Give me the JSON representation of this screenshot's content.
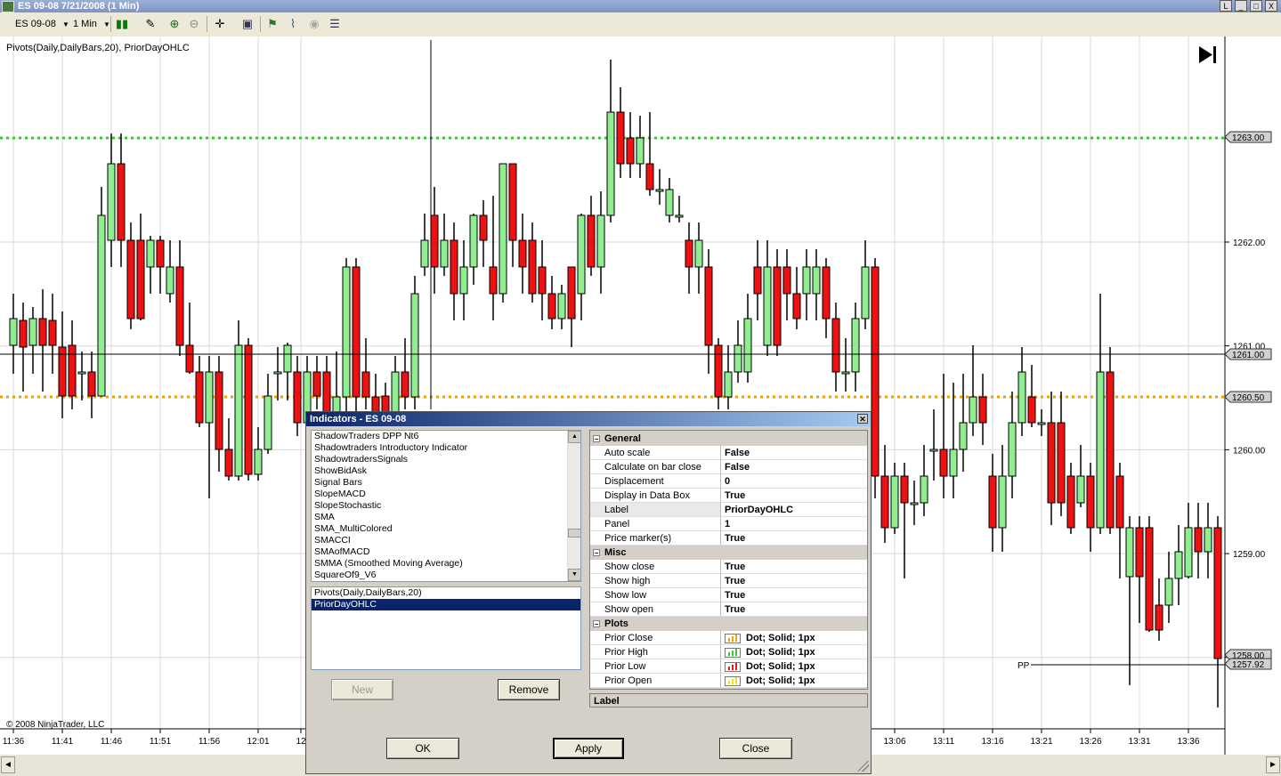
{
  "window": {
    "title": "ES 09-08  7/21/2008 (1 Min)",
    "min_label": "L",
    "restore_label": "_",
    "max_label": "□",
    "close_label": "X"
  },
  "toolbar": {
    "instrument": "ES 09-08",
    "interval": "1 Min"
  },
  "chart": {
    "indicator_label": "Pivots(Daily,DailyBars,20), PriorDayOHLC",
    "copyright": "© 2008 NinjaTrader, LLC",
    "pp_label": "PP",
    "price_ticks": [
      "1263.00",
      "1262.00",
      "1261.00",
      "1260.00",
      "1259.00",
      "1258.00"
    ],
    "price_markers": [
      "1263.00",
      "1261.00",
      "1260.50",
      "1258.00",
      "1257.92"
    ],
    "time_ticks": [
      "11:36",
      "11:41",
      "11:46",
      "11:51",
      "11:56",
      "12:01",
      "12",
      "13:06",
      "13:11",
      "13:16",
      "13:21",
      "13:26",
      "13:31",
      "13:36"
    ],
    "colors": {
      "up": "#90ee90",
      "down": "#ee1111",
      "prior_high": "#33cc33",
      "prior_close": "#f0a000",
      "grid": "#d8d8d8"
    }
  },
  "dialog": {
    "title": "Indicators - ES 09-08",
    "available": [
      "ShadowTraders DPP Nt6",
      "Shadowtraders Introductory Indicator",
      "ShadowtradersSignals",
      "ShowBidAsk",
      "Signal Bars",
      "SlopeMACD",
      "SlopeStochastic",
      "SMA",
      "SMA_MultiColored",
      "SMACCI",
      "SMAofMACD",
      "SMMA (Smoothed Moving Average)",
      "SquareOf9_V6"
    ],
    "applied": [
      "Pivots(Daily,DailyBars,20)",
      "PriorDayOHLC"
    ],
    "new_label": "New",
    "remove_label": "Remove",
    "ok_label": "OK",
    "apply_label": "Apply",
    "close_label": "Close",
    "description_title": "Label",
    "properties": {
      "general_title": "General",
      "general": [
        {
          "k": "Auto scale",
          "v": "False"
        },
        {
          "k": "Calculate on bar close",
          "v": "False"
        },
        {
          "k": "Displacement",
          "v": "0"
        },
        {
          "k": "Display in Data Box",
          "v": "True"
        },
        {
          "k": "Label",
          "v": "PriorDayOHLC"
        },
        {
          "k": "Panel",
          "v": "1"
        },
        {
          "k": "Price marker(s)",
          "v": "True"
        }
      ],
      "misc_title": "Misc",
      "misc": [
        {
          "k": "Show close",
          "v": "True"
        },
        {
          "k": "Show high",
          "v": "True"
        },
        {
          "k": "Show low",
          "v": "True"
        },
        {
          "k": "Show open",
          "v": "True"
        }
      ],
      "plots_title": "Plots",
      "plots": [
        {
          "k": "Prior Close",
          "v": "Dot; Solid; 1px",
          "color": "#f0a000"
        },
        {
          "k": "Prior High",
          "v": "Dot; Solid; 1px",
          "color": "#33cc33"
        },
        {
          "k": "Prior Low",
          "v": "Dot; Solid; 1px",
          "color": "#ee1111"
        },
        {
          "k": "Prior Open",
          "v": "Dot; Solid; 1px",
          "color": "#e8e800"
        }
      ]
    }
  }
}
